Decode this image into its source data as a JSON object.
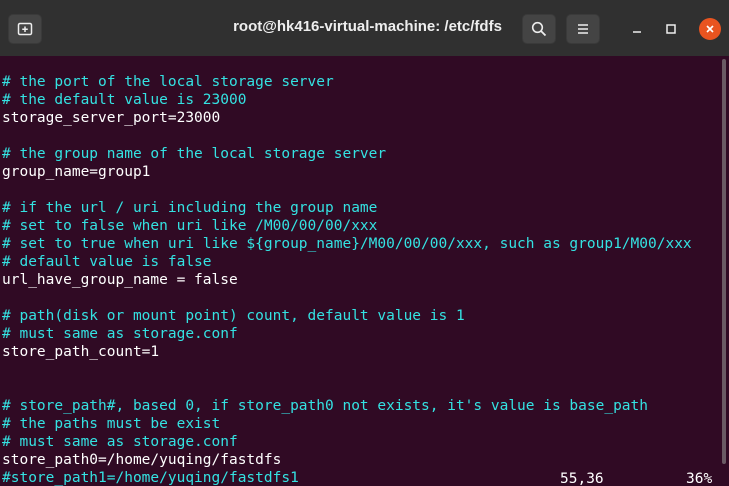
{
  "window": {
    "title": "root@hk416-virtual-machine: /etc/fdfs",
    "colors": {
      "titlebar": "#303030",
      "terminal_bg": "#300a24",
      "comment": "#34e2e2",
      "text": "#ffffff",
      "close_button": "#e95420"
    }
  },
  "icons": {
    "new_tab": "new-tab-icon",
    "search": "search-icon",
    "menu": "hamburger-menu-icon",
    "minimize": "minimize-icon",
    "maximize": "maximize-icon",
    "close": "close-icon"
  },
  "terminal": {
    "lines": [
      {
        "type": "comment",
        "text": "# the port of the local storage server"
      },
      {
        "type": "comment",
        "text": "# the default value is 23000"
      },
      {
        "type": "text",
        "text": "storage_server_port=23000"
      },
      {
        "type": "blank",
        "text": ""
      },
      {
        "type": "comment",
        "text": "# the group name of the local storage server"
      },
      {
        "type": "text",
        "text": "group_name=group1"
      },
      {
        "type": "blank",
        "text": ""
      },
      {
        "type": "comment",
        "text": "# if the url / uri including the group name"
      },
      {
        "type": "comment",
        "text": "# set to false when uri like /M00/00/00/xxx"
      },
      {
        "type": "comment",
        "text": "# set to true when uri like ${group_name}/M00/00/00/xxx, such as group1/M00/xxx"
      },
      {
        "type": "comment",
        "text": "# default value is false"
      },
      {
        "type": "text",
        "text": "url_have_group_name = false"
      },
      {
        "type": "blank",
        "text": ""
      },
      {
        "type": "comment",
        "text": "# path(disk or mount point) count, default value is 1"
      },
      {
        "type": "comment",
        "text": "# must same as storage.conf"
      },
      {
        "type": "text",
        "text": "store_path_count=1"
      },
      {
        "type": "blank",
        "text": ""
      },
      {
        "type": "blank",
        "text": ""
      },
      {
        "type": "comment",
        "text": "# store_path#, based 0, if store_path0 not exists, it's value is base_path"
      },
      {
        "type": "comment",
        "text": "# the paths must be exist"
      },
      {
        "type": "comment",
        "text": "# must same as storage.conf"
      },
      {
        "type": "text",
        "text": "store_path0=/home/yuqing/fastdfs"
      },
      {
        "type": "comment",
        "text": "#store_path1=/home/yuqing/fastdfs1"
      }
    ],
    "status": {
      "cursor_position": "55,36",
      "percent": "36%"
    }
  }
}
